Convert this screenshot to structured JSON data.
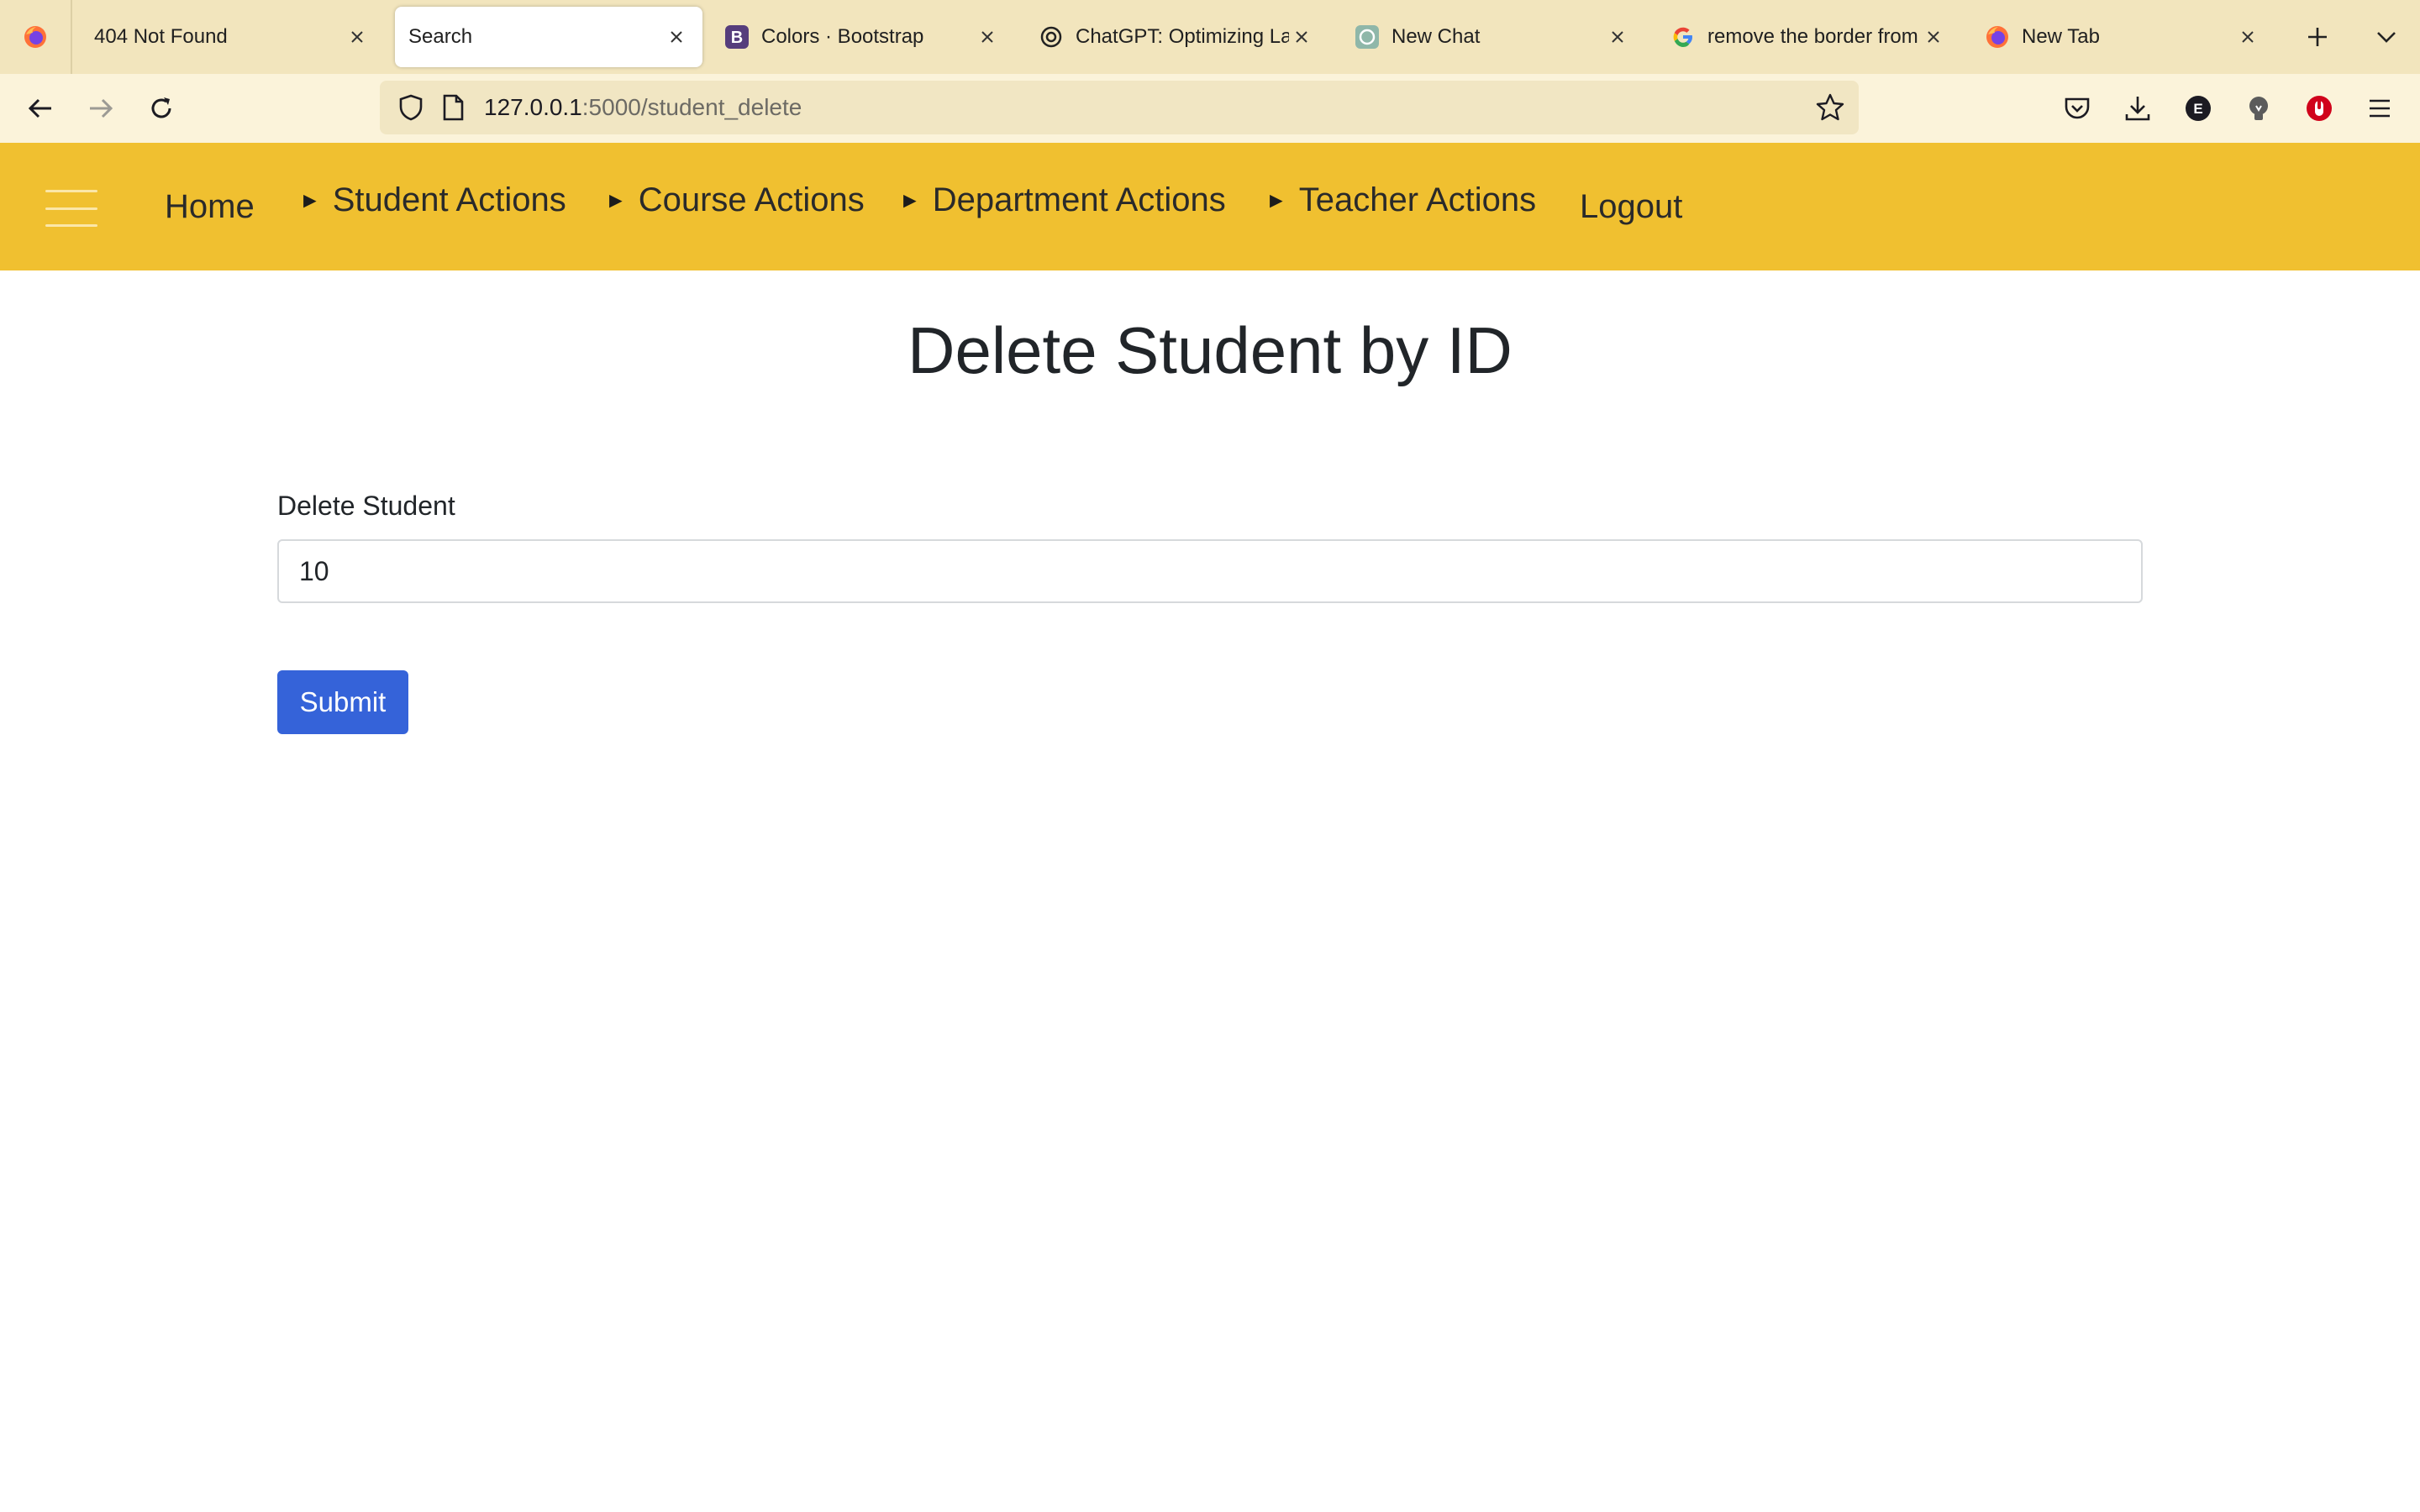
{
  "browser": {
    "tabs": [
      {
        "title": "404 Not Found",
        "icon": "firefox-icon"
      },
      {
        "title": "Search",
        "icon": "none",
        "active": true
      },
      {
        "title": "Colors · Bootstrap",
        "icon": "bootstrap-icon"
      },
      {
        "title": "ChatGPT: Optimizing Lan",
        "icon": "chatgpt-icon"
      },
      {
        "title": "New Chat",
        "icon": "chatgpt-icon"
      },
      {
        "title": "remove the border from s",
        "icon": "google-icon"
      },
      {
        "title": "New Tab",
        "icon": "firefox-icon"
      }
    ],
    "url": {
      "host": "127.0.0.1",
      "rest": ":5000/student_delete"
    },
    "extension_badge": "E",
    "colors": {
      "tabstrip": "#f2e5bd",
      "toolbar": "#fbf3da",
      "urlbar": "#f1e6c3"
    }
  },
  "navbar": {
    "items": [
      {
        "label": "Home",
        "caret": ""
      },
      {
        "label": "Student Actions",
        "caret": "►"
      },
      {
        "label": "Course Actions",
        "caret": "►"
      },
      {
        "label": "Department Actions",
        "caret": "►"
      },
      {
        "label": "Teacher Actions",
        "caret": "►"
      },
      {
        "label": "Logout",
        "caret": ""
      }
    ],
    "color": "#f0c030"
  },
  "main": {
    "title": "Delete Student by ID",
    "form": {
      "label": "Delete Student",
      "value": "10",
      "submit_label": "Submit"
    },
    "accent_color": "#3563d9"
  }
}
